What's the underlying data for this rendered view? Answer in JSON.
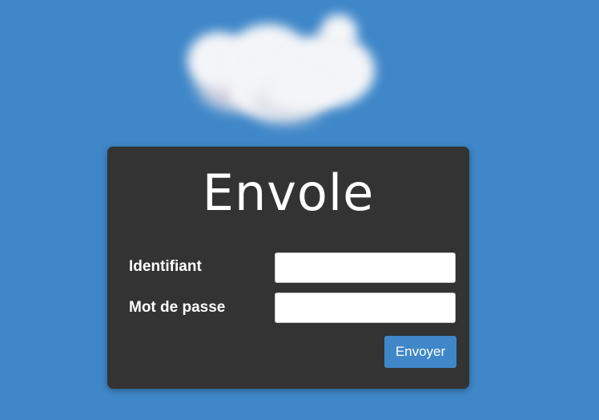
{
  "brand": {
    "logo_icon": "cloud-icon",
    "app_title": "Envole"
  },
  "login_form": {
    "username_label": "Identifiant",
    "username_value": "",
    "password_label": "Mot de passe",
    "password_value": "",
    "submit_label": "Envoyer"
  },
  "colors": {
    "background": "#3f87c9",
    "card": "#333333",
    "accent_button": "#3f87c9",
    "text": "#ffffff"
  }
}
